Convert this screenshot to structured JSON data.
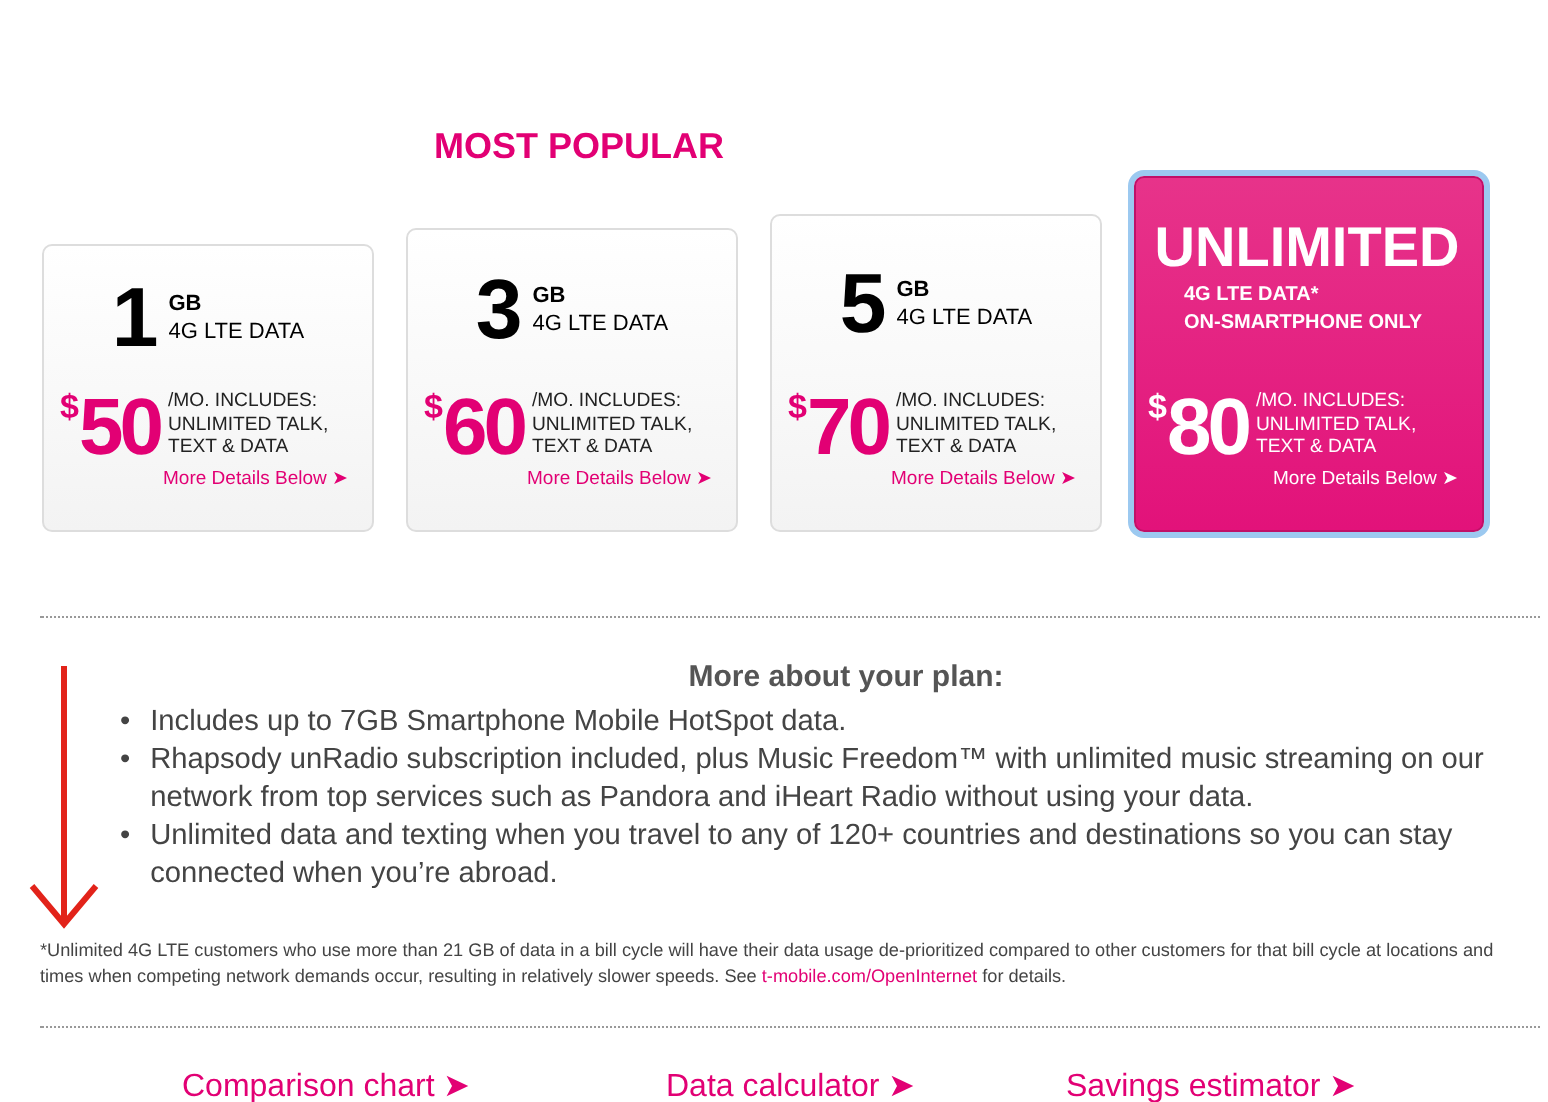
{
  "banner": "MOST POPULAR",
  "plans": [
    {
      "kind": "capped",
      "selected": false,
      "amount": "1",
      "unit": "GB",
      "data": "4G LTE DATA",
      "currency": "$",
      "price": "50",
      "includes": "/MO. INCLUDES: UNLIMITED TALK, TEXT & DATA",
      "link": "More Details Below ➤"
    },
    {
      "kind": "capped",
      "selected": false,
      "amount": "3",
      "unit": "GB",
      "data": "4G LTE DATA",
      "currency": "$",
      "price": "60",
      "includes": "/MO. INCLUDES: UNLIMITED TALK, TEXT & DATA",
      "link": "More Details Below ➤"
    },
    {
      "kind": "capped",
      "selected": false,
      "amount": "5",
      "unit": "GB",
      "data": "4G LTE DATA",
      "currency": "$",
      "price": "70",
      "includes": "/MO. INCLUDES: UNLIMITED TALK, TEXT & DATA",
      "link": "More Details Below ➤"
    },
    {
      "kind": "unlimited",
      "selected": true,
      "amount": "UNLIMITED",
      "unit": "4G LTE DATA*",
      "data": "ON-SMARTPHONE ONLY",
      "currency": "$",
      "price": "80",
      "includes": "/MO. INCLUDES: UNLIMITED TALK, TEXT & DATA",
      "link": "More Details Below ➤"
    }
  ],
  "more": {
    "heading": "More about your plan:",
    "bullets": [
      {
        "marker": "•",
        "text": "Includes up to 7GB Smartphone Mobile HotSpot data."
      },
      {
        "marker": "•",
        "text": "Rhapsody unRadio subscription included, plus Music Freedom™ with unlimited music streaming on our network from top services such as Pandora and iHeart Radio without using your data."
      },
      {
        "marker": "•",
        "text": "Unlimited data and texting when you travel to any of 120+ countries and destinations so you can stay connected when you’re abroad."
      }
    ]
  },
  "footnote": {
    "text": "*Unlimited 4G LTE customers who use more than 21 GB of data in a bill cycle will have their data usage de-prioritized compared to other customers for that bill cycle at locations and times when competing network demands occur, resulting in relatively slower speeds. See",
    "link": "t-mobile.com/OpenInternet",
    "after": "for details."
  },
  "links": [
    "Comparison chart ➤",
    "Data calculator ➤",
    "Savings estimator ➤"
  ]
}
